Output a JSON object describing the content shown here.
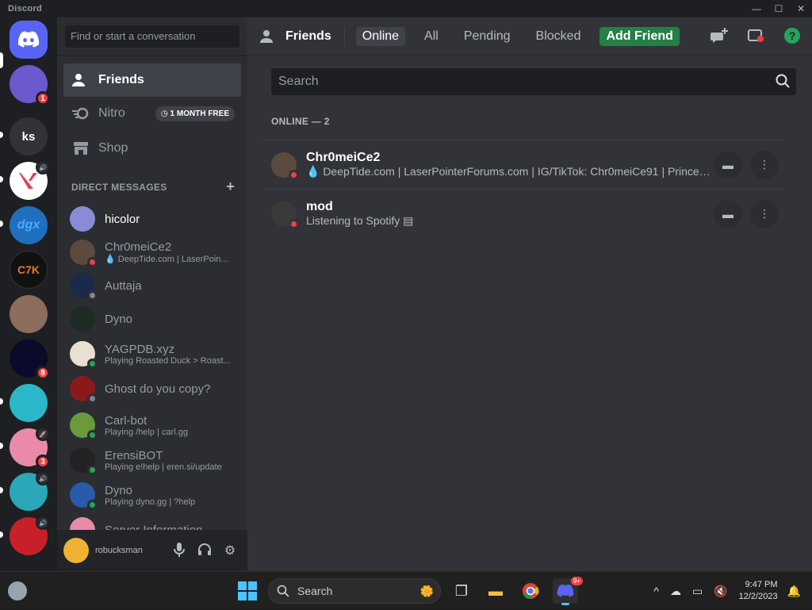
{
  "window": {
    "title": "Discord",
    "controls": [
      "—",
      "☐",
      "✕"
    ]
  },
  "servers": [
    {
      "id": "home",
      "label": "",
      "color": "#5865f2",
      "icon": "discord-icon"
    },
    {
      "id": "s1",
      "label": "",
      "color": "#6a5acd",
      "badge": "1"
    },
    {
      "id": "s2",
      "label": "ks",
      "color": "#313338"
    },
    {
      "id": "s3",
      "label": "",
      "color": "#ffffff",
      "vol": "🔊"
    },
    {
      "id": "s4",
      "label": "dgx",
      "color": "#1f6fbf"
    },
    {
      "id": "s5",
      "label": "C7K",
      "color": "#111111"
    },
    {
      "id": "s6",
      "label": "",
      "color": "#8c6c5c"
    },
    {
      "id": "s7",
      "label": "",
      "color": "#0a0a2a",
      "badge": "8"
    },
    {
      "id": "s8",
      "label": "",
      "color": "#2ab7c8"
    },
    {
      "id": "s9",
      "label": "",
      "color": "#e88aa8",
      "badge": "3",
      "vol": "🚀"
    },
    {
      "id": "s10",
      "label": "",
      "color": "#2aa7b8",
      "vol": "🔊"
    },
    {
      "id": "s11",
      "label": "",
      "color": "#c8202a",
      "vol": "🔊"
    }
  ],
  "tooltip": "dgx",
  "dm_search_placeholder": "Find or start a conversation",
  "nav": {
    "friends": "Friends",
    "nitro": "Nitro",
    "nitro_badge": "1 MONTH FREE",
    "shop": "Shop"
  },
  "dm_header": "DIRECT MESSAGES",
  "dms": [
    {
      "name": "hicolor",
      "sub": "",
      "color": "#8a8ad6",
      "status": ""
    },
    {
      "name": "Chr0meiCe2",
      "sub": "💧 DeepTide.com | LaserPoin...",
      "color": "#5c4a3e",
      "status": "#f23f43"
    },
    {
      "name": "Auttaja",
      "sub": "",
      "color": "#1b2a4a",
      "status": "#80848e"
    },
    {
      "name": "Dyno",
      "sub": "",
      "color": "#1e2a23",
      "status": ""
    },
    {
      "name": "YAGPDB.xyz",
      "sub": "Playing Roasted Duck > Roast...",
      "color": "#e8e0d0",
      "status": "#23a55a"
    },
    {
      "name": "Ghost do you copy?",
      "sub": "",
      "color": "#8a1a1a",
      "status": "#80848e"
    },
    {
      "name": "Carl-bot",
      "sub": "Playing /help | carl.gg",
      "color": "#6a9a3a",
      "status": "#23a55a"
    },
    {
      "name": "ErensiBOT",
      "sub": "Playing e!help | eren.si/update",
      "color": "#222222",
      "status": "#23a55a"
    },
    {
      "name": "Dyno",
      "sub": "Playing dyno.gg | ?help",
      "color": "#2a5aa8",
      "status": "#23a55a"
    },
    {
      "name": "Server Information",
      "sub": "",
      "color": "#e88aa8",
      "status": ""
    }
  ],
  "user": {
    "name": "",
    "tag": "robucksman"
  },
  "topbar": {
    "title": "Friends",
    "tabs": [
      "Online",
      "All",
      "Pending",
      "Blocked"
    ],
    "add_friend": "Add Friend"
  },
  "main_search_placeholder": "Search",
  "online_header": "ONLINE — 2",
  "friends": [
    {
      "name": "Chr0meiCe2",
      "sub": "💧 DeepTide.com | LaserPointerForums.com | IG/TikTok: Chr0meiCe91 | Princeton ...",
      "color": "#5c4a3e"
    },
    {
      "name": "mod",
      "sub": "Listening to Spotify ▤",
      "color": "#3a3a3a"
    }
  ],
  "taskbar": {
    "search": "Search",
    "time": "9:47 PM",
    "date": "12/2/2023",
    "discord_badge": "9+"
  }
}
